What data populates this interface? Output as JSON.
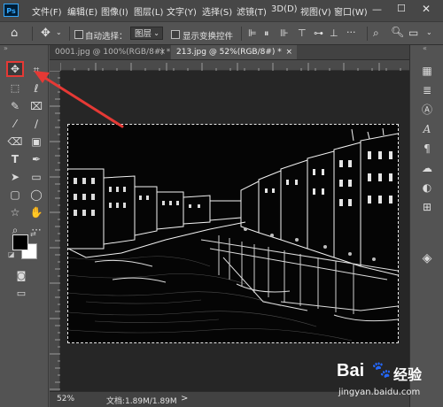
{
  "app": {
    "logo": "Ps"
  },
  "menu": [
    "文件(F)",
    "编辑(E)",
    "图像(I)",
    "图层(L)",
    "文字(Y)",
    "选择(S)",
    "滤镜(T)",
    "3D(D)",
    "视图(V)",
    "窗口(W)"
  ],
  "options": {
    "auto_select_label": "自动选择：",
    "auto_select_value": "图层",
    "show_transform_label": "显示变换控件",
    "more": "···"
  },
  "tabs": [
    {
      "label": "0001.jpg @ 100%(RGB/8#) *",
      "close": "×"
    },
    {
      "label": "213.jpg @ 52%(RGB/8#) *",
      "close": "×"
    }
  ],
  "status": {
    "zoom": "52%",
    "doc_info": "文档:1.89M/1.89M",
    "arrow": ">"
  },
  "colors": {
    "accent": "#31a8ff",
    "highlight": "#e53935",
    "menubar": "#474747",
    "panel": "#535353",
    "canvas": "#262626"
  },
  "icons": {
    "tools": [
      "move-icon",
      "crop-icon",
      "marquee-icon",
      "lasso-icon",
      "quick-select-icon",
      "crop-tool-icon",
      "eyedropper-icon",
      "brush-icon",
      "eraser-icon",
      "gradient-icon",
      "type-icon",
      "pen-icon",
      "path-select-icon",
      "rectangle-icon",
      "rect-shape-icon",
      "ellipse-icon",
      "star-icon",
      "hand-icon",
      "zoom-icon",
      "more-icon"
    ],
    "panel": [
      "history-icon",
      "properties-icon",
      "character-icon",
      "paragraph-icon",
      "libraries-icon",
      "adjustments-icon",
      "layers-icon"
    ]
  },
  "watermark": {
    "brand": "Bai",
    "brand2": "经验",
    "url": "jingyan.baidu.com"
  }
}
